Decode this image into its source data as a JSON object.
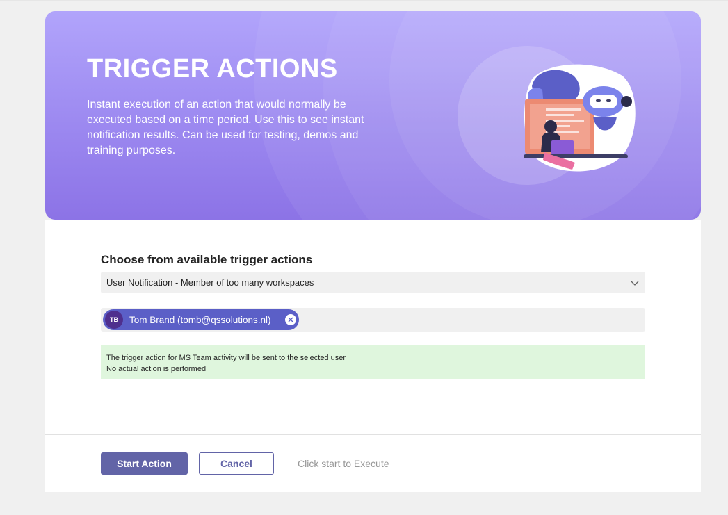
{
  "hero": {
    "title": "TRIGGER ACTIONS",
    "description": "Instant execution of an action that would normally be executed based on a time period. Use this to see instant notification results. Can be used for testing, demos and training purposes.",
    "illustration_icon": "robot-with-laptop-user-illustration"
  },
  "form": {
    "section_label": "Choose from available trigger actions",
    "selected_action": "User Notification - Member of too many workspaces",
    "user_pill": {
      "initials": "TB",
      "name": "Tom Brand (tomb@qssolutions.nl)"
    },
    "notice_lines": [
      "The trigger action for MS Team activity will be sent to the selected user",
      "No actual action is performed"
    ]
  },
  "footer": {
    "start_label": "Start Action",
    "cancel_label": "Cancel",
    "hint": "Click start to Execute"
  },
  "colors": {
    "brand": "#6264a7",
    "pill": "#5b5fc7",
    "notice_bg": "#dff6dd",
    "hero_top": "#b1a4fb",
    "hero_bottom": "#8c73e6"
  }
}
